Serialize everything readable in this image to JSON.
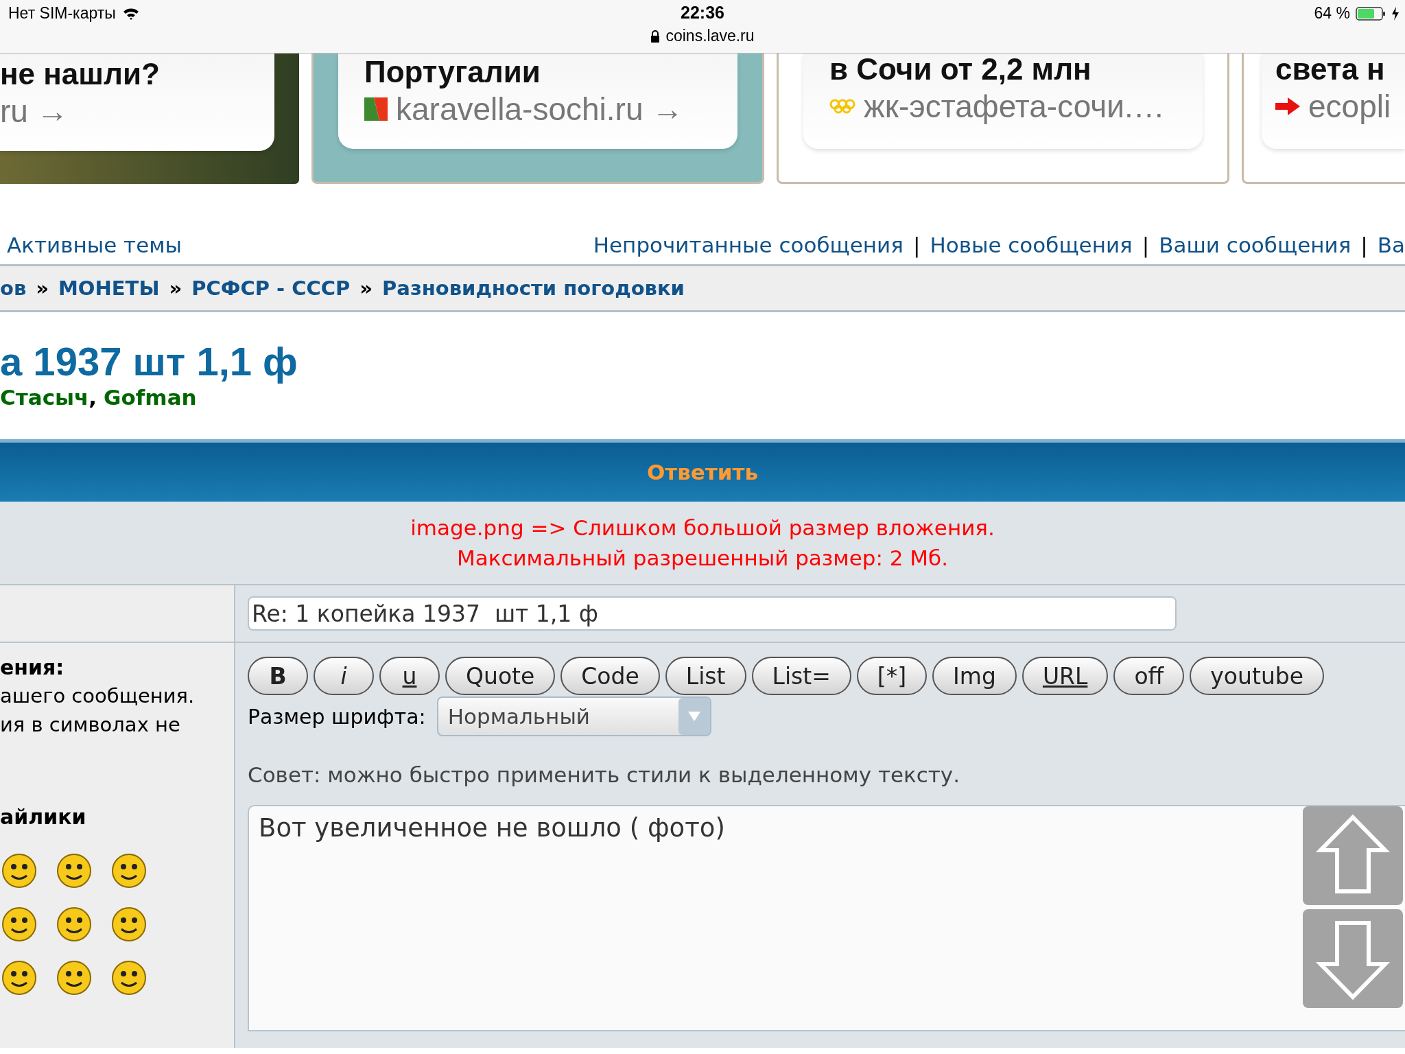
{
  "status_bar": {
    "carrier": "Нет SIM-карты",
    "time": "22:36",
    "url": "coins.lave.ru",
    "battery": "64 %"
  },
  "ads": [
    {
      "title": "не нашли?",
      "link": "ru →"
    },
    {
      "title": "Португалии",
      "link": "karavella-sochi.ru →"
    },
    {
      "title": "в Сочи от 2,2 млн",
      "link": "жк-эстафета-сочи.…"
    },
    {
      "title": "света н",
      "link": "ecopli"
    }
  ],
  "nav": {
    "left_link": "Активные темы",
    "right_links": [
      {
        "label": "Непрочитанные сообщения",
        "separator": "|"
      },
      {
        "label": "Новые сообщения",
        "separator": "|"
      },
      {
        "label": "Ваши сообщения",
        "separator": "|"
      },
      {
        "label": "Ва"
      }
    ]
  },
  "breadcrumbs": [
    {
      "label": "ов",
      "separator": "»"
    },
    {
      "label": "МОНЕТЫ",
      "separator": "»"
    },
    {
      "label": "РСФСР - СССР",
      "separator": "»"
    },
    {
      "label": "Разновидности погодовки"
    }
  ],
  "topic": {
    "title": "а 1937 шт 1,1 ф",
    "moderators": [
      {
        "name": "Стасыч",
        "separator": ","
      },
      {
        "name": "Gofman"
      }
    ]
  },
  "reply": {
    "header": "Ответить",
    "errors": [
      "image.png => Слишком большой размер вложения.",
      "Максимальный разрешенный размер: 2 Мб."
    ],
    "subject": "Re: 1 копейка 1937  шт 1,1 ф",
    "message_label": "ения:",
    "message_hint_lines": [
      "ашего сообщения.",
      "ия в символах не"
    ],
    "smilies_label": "айлики",
    "format_buttons": [
      {
        "label": "B",
        "kind": "bold"
      },
      {
        "label": "i",
        "kind": "italic"
      },
      {
        "label": "u",
        "kind": "underline"
      },
      {
        "label": "Quote",
        "kind": "plain"
      },
      {
        "label": "Code",
        "kind": "plain"
      },
      {
        "label": "List",
        "kind": "plain"
      },
      {
        "label": "List=",
        "kind": "plain"
      },
      {
        "label": "[*]",
        "kind": "plain"
      },
      {
        "label": "Img",
        "kind": "plain"
      },
      {
        "label": "URL",
        "kind": "underline"
      },
      {
        "label": "off",
        "kind": "plain"
      },
      {
        "label": "youtube",
        "kind": "plain"
      }
    ],
    "font_size_label": "Размер шрифта:",
    "font_size_value": "Нормальный",
    "tip": "Совет: можно быстро применить стили к выделенному тексту.",
    "message": "Вот увеличенное не вошло ( фото)"
  }
}
